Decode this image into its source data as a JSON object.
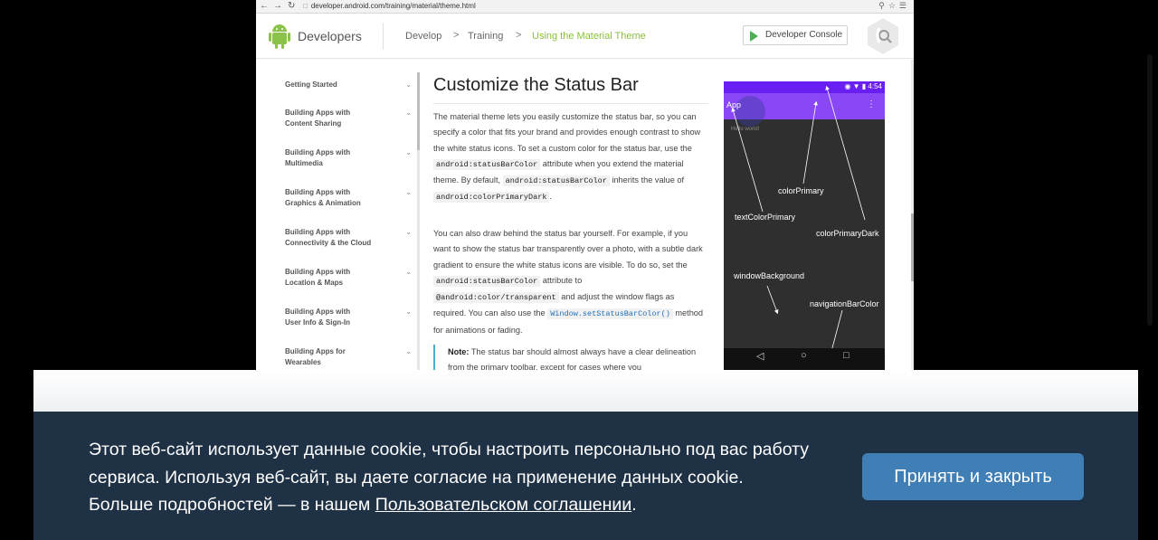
{
  "browser": {
    "url": "developer.android.com/training/material/theme.html",
    "back_icon": "back-arrow-icon",
    "forward_icon": "forward-arrow-icon",
    "reload_icon": "reload-icon"
  },
  "site_header": {
    "brand": "Developers",
    "breadcrumbs": [
      "Develop",
      "Training",
      "Using the Material Theme"
    ],
    "separator": ">",
    "console_button": "Developer Console"
  },
  "sidebar": {
    "items": [
      {
        "label_lines": [
          "Getting Started"
        ]
      },
      {
        "label_lines": [
          "Building Apps with",
          "Content Sharing"
        ]
      },
      {
        "label_lines": [
          "Building Apps with",
          "Multimedia"
        ]
      },
      {
        "label_lines": [
          "Building Apps with",
          "Graphics & Animation"
        ]
      },
      {
        "label_lines": [
          "Building Apps with",
          "Connectivity & the Cloud"
        ]
      },
      {
        "label_lines": [
          "Building Apps with",
          "Location & Maps"
        ]
      },
      {
        "label_lines": [
          "Building Apps with",
          "User Info & Sign-In"
        ]
      },
      {
        "label_lines": [
          "Building Apps for",
          "Wearables"
        ]
      }
    ]
  },
  "article": {
    "title": "Customize the Status Bar",
    "p1": {
      "t1": "The material theme lets you easily customize the status bar, so you can specify a color that fits your brand and provides enough contrast to show the white status icons. To set a custom color for the status bar, use the",
      "c1": "android:statusBarColor",
      "t2": "attribute when you extend the material theme. By default,",
      "c2": "android:statusBarColor",
      "t3": "inherits the value of",
      "c3": "android:colorPrimaryDark",
      "t4": "."
    },
    "p2": {
      "t1": "You can also draw behind the status bar yourself. For example, if you want to show the status bar transparently over a photo, with a subtle dark gradient to ensure the white status icons are visible. To do so, set the",
      "c1": "android:statusBarColor",
      "t2": "attribute to",
      "c2": "@android:color/transparent",
      "t3": "and adjust the window flags as required. You can also use the",
      "c3": "Window.setStatusBarColor()",
      "t4": "method for animations or fading."
    },
    "note_label": "Note:",
    "note_text": "The status bar should almost always have a clear delineation from the primary toolbar, except for cases where you"
  },
  "phone": {
    "time": "4:54",
    "app_title": "App",
    "hello": "Hello world!",
    "labels": {
      "colorPrimary": "colorPrimary",
      "textColorPrimary": "textColorPrimary",
      "colorPrimaryDark": "colorPrimaryDark",
      "windowBackground": "windowBackground",
      "navigationBarColor": "navigationBarColor"
    },
    "colors": {
      "status": "#6a1ff2",
      "appbar": "#8a47f5",
      "window": "#2f2f2f"
    }
  },
  "cookie": {
    "text_before": "Этот веб-сайт использует данные cookie, чтобы настроить персонально под вас работу сервиса. Используя веб-сайт, вы даете согласие на применение данных cookie. Больше подробностей — в нашем ",
    "link": "Пользовательском соглашении",
    "text_after": ".",
    "accept_button": "Принять и закрыть",
    "colors": {
      "banner": "#1f3145",
      "button": "#3f7fb6"
    }
  }
}
